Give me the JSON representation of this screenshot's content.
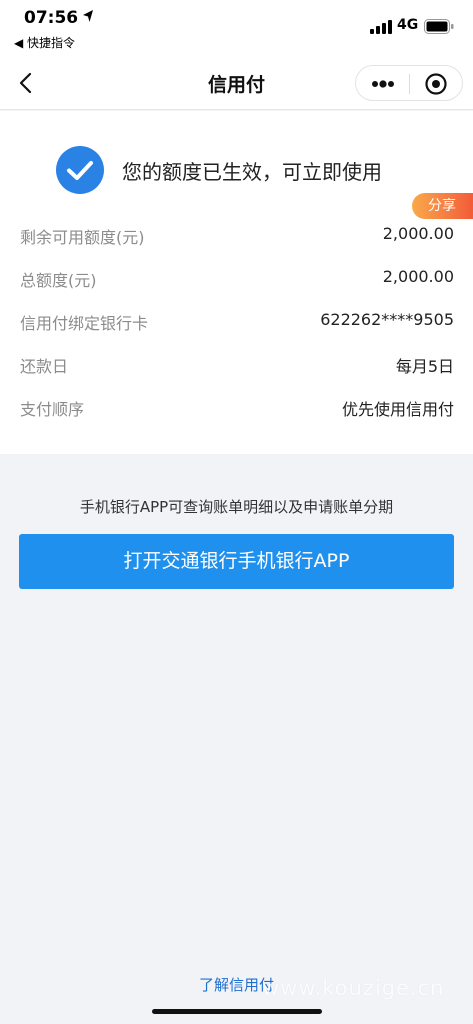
{
  "status_bar": {
    "time": "07:56",
    "back_label": "◀ 快捷指令",
    "network": "4G"
  },
  "nav": {
    "title": "信用付"
  },
  "card": {
    "success_message": "您的额度已生效，可立即使用",
    "share_label": "分享",
    "rows": [
      {
        "label": "剩余可用额度(元)",
        "value": "2,000.00"
      },
      {
        "label": "总额度(元)",
        "value": "2,000.00"
      },
      {
        "label": "信用付绑定银行卡",
        "value": "622262****9505"
      },
      {
        "label": "还款日",
        "value": "每月5日"
      },
      {
        "label": "支付顺序",
        "value": "优先使用信用付"
      }
    ]
  },
  "main": {
    "hint": "手机银行APP可查询账单明细以及申请账单分期",
    "button_label": "打开交通银行手机银行APP",
    "learn_link": "了解信用付",
    "watermark": "www.kouzige.cn"
  },
  "colors": {
    "accent": "#1f90ee",
    "check": "#2a82e4",
    "share_start": "#f9a94b",
    "share_end": "#f25c3a"
  },
  "icons": [
    "location-arrow-icon",
    "signal-icon",
    "battery-icon",
    "back-chevron-icon",
    "more-icon",
    "mini-program-close-icon",
    "check-circle-icon"
  ]
}
